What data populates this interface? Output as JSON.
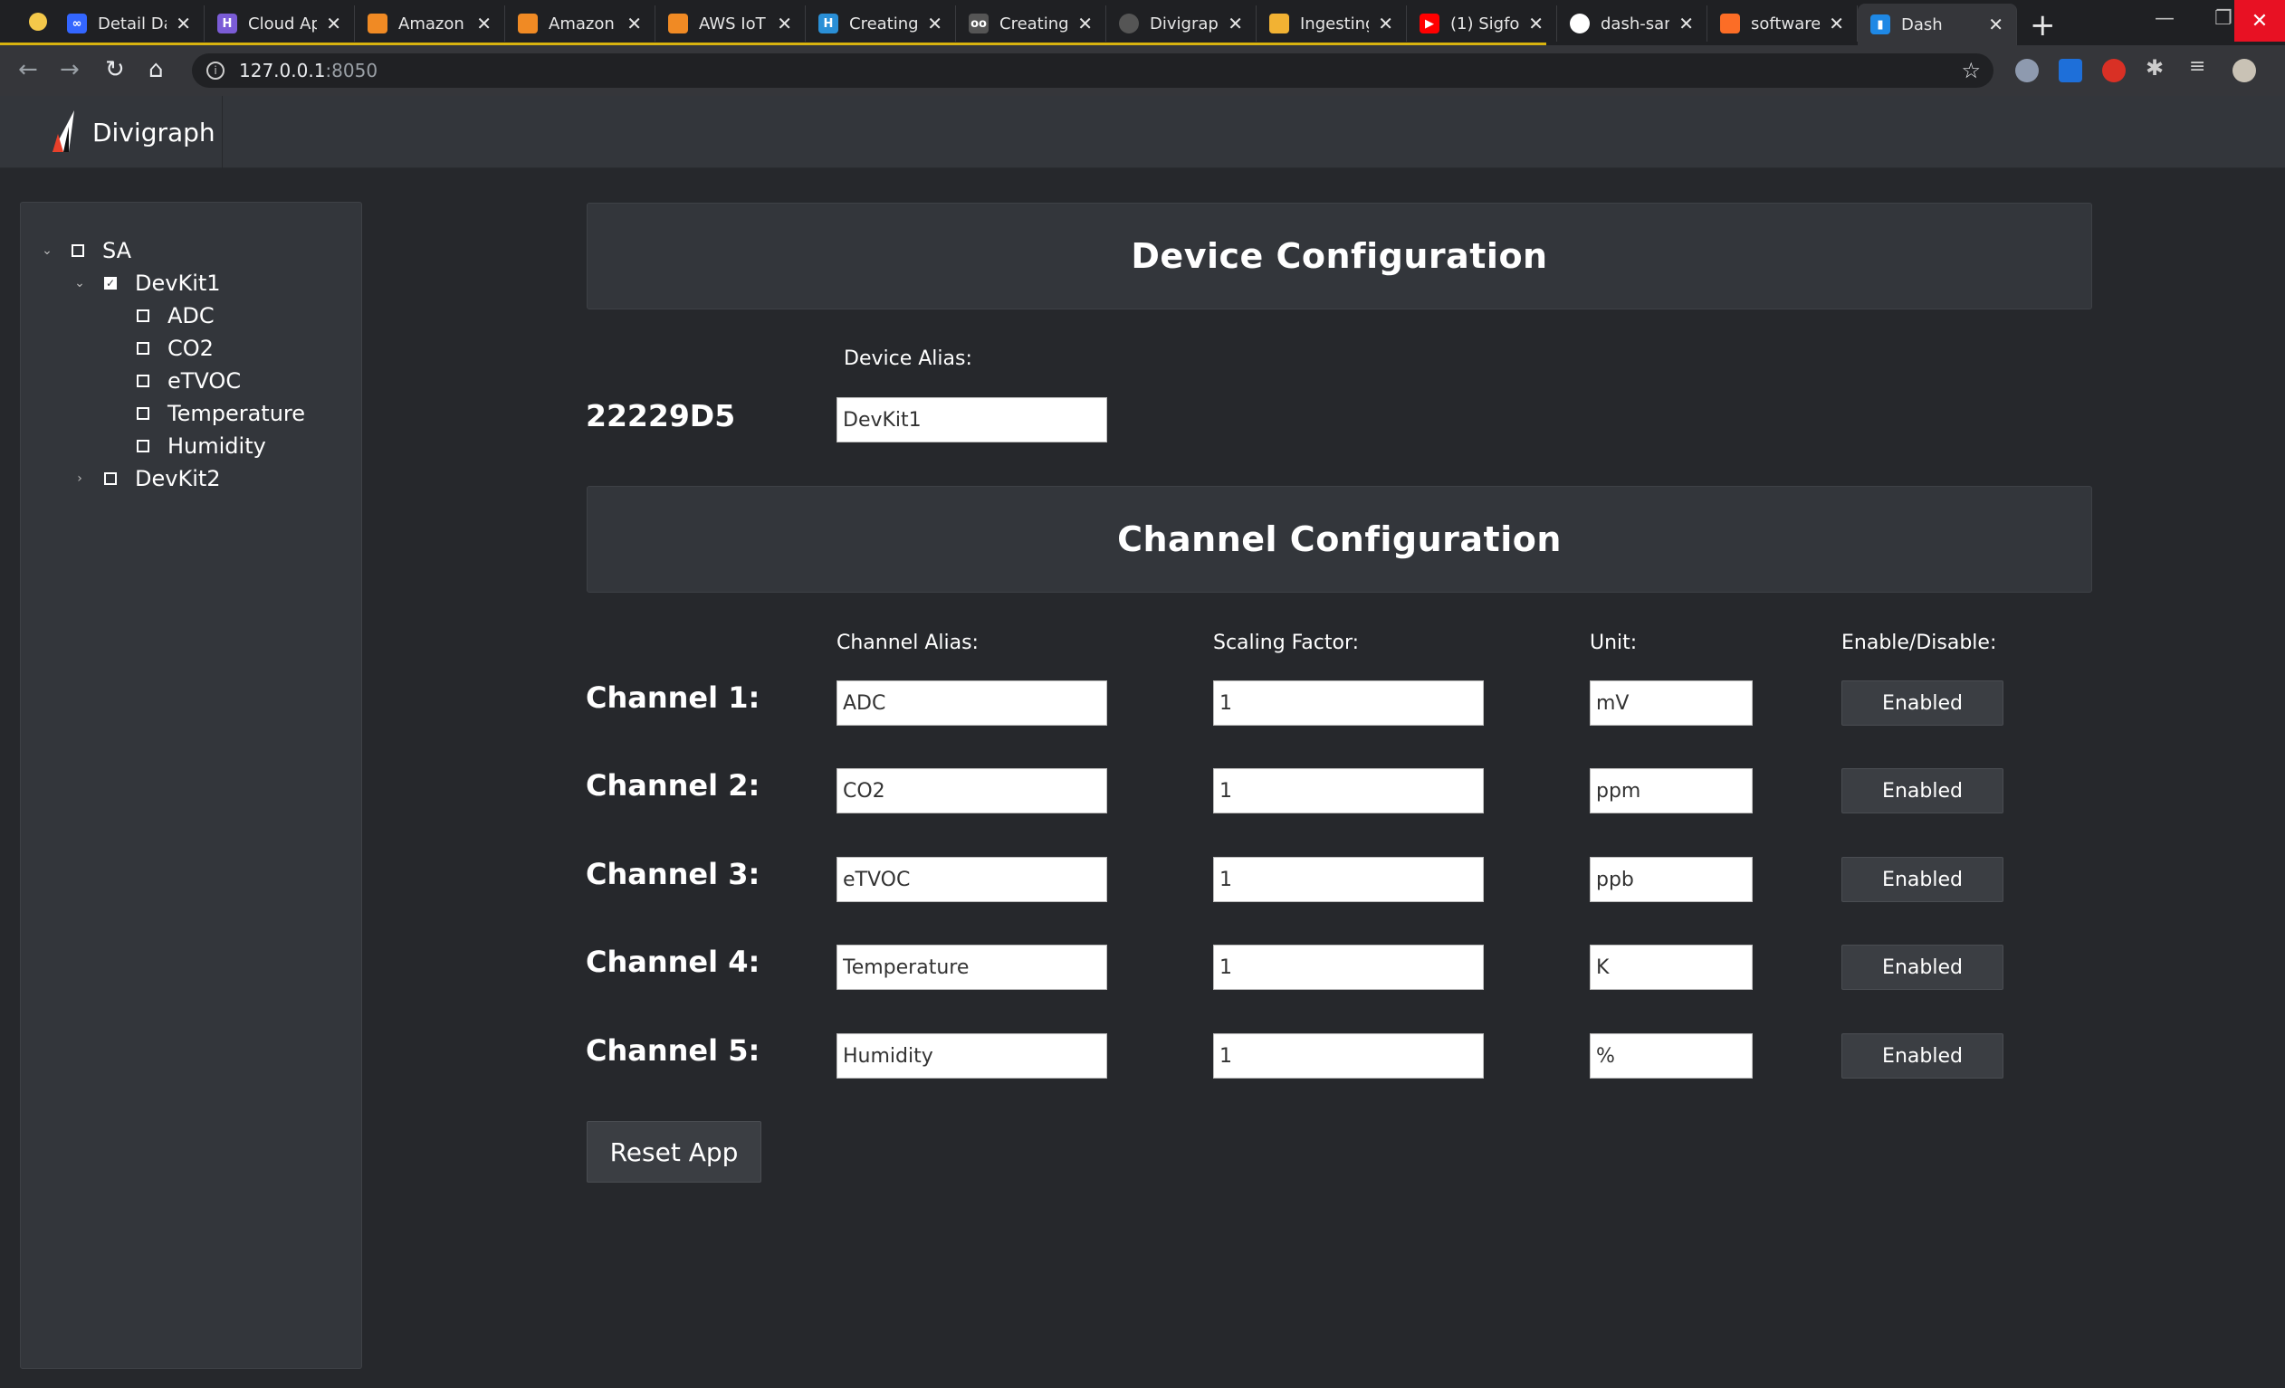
{
  "browser": {
    "tabs": [
      {
        "title": "Detail Da",
        "icon": "infinity-icon",
        "color": "#3366ff"
      },
      {
        "title": "Cloud Ap",
        "icon": "h-logo-icon",
        "color": "#7b5cd6"
      },
      {
        "title": "Amazon",
        "icon": "aws-hexagon-icon",
        "color": "#f08a24"
      },
      {
        "title": "Amazon",
        "icon": "aws-hexagon-icon",
        "color": "#f08a24"
      },
      {
        "title": "AWS IoT",
        "icon": "aws-hexagon-icon",
        "color": "#f08a24"
      },
      {
        "title": "Creating",
        "icon": "h-square-icon",
        "color": "#2a8fd6"
      },
      {
        "title": "Creating",
        "icon": "glasses-icon",
        "color": "#555555"
      },
      {
        "title": "Divigrap",
        "icon": "globe-icon",
        "color": "#555555"
      },
      {
        "title": "Ingesting",
        "icon": "box-icon",
        "color": "#f2b233"
      },
      {
        "title": "(1) Sigfo",
        "icon": "youtube-icon",
        "color": "#ff0000"
      },
      {
        "title": "dash-san",
        "icon": "github-icon",
        "color": "#ffffff"
      },
      {
        "title": "software",
        "icon": "gitlab-icon",
        "color": "#fc6d26"
      },
      {
        "title": "Dash",
        "icon": "dash-chart-icon",
        "color": "#1e88e5"
      }
    ],
    "url_host": "127.0.0.1",
    "url_port": ":8050"
  },
  "app": {
    "brand_name": "Divigraph"
  },
  "tree": {
    "root": "SA",
    "devkit1": "DevKit1",
    "channels": [
      "ADC",
      "CO2",
      "eTVOC",
      "Temperature",
      "Humidity"
    ],
    "devkit2": "DevKit2"
  },
  "device_config": {
    "title": "Device Configuration",
    "alias_label": "Device Alias:",
    "device_id": "22229D5",
    "alias_value": "DevKit1"
  },
  "channel_config": {
    "title": "Channel Configuration",
    "headers": {
      "alias": "Channel Alias:",
      "scaling": "Scaling Factor:",
      "unit": "Unit:",
      "enable": "Enable/Disable:"
    },
    "channels": [
      {
        "label": "Channel 1:",
        "alias": "ADC",
        "scaling": "1",
        "unit": "mV",
        "status": "Enabled"
      },
      {
        "label": "Channel 2:",
        "alias": "CO2",
        "scaling": "1",
        "unit": "ppm",
        "status": "Enabled"
      },
      {
        "label": "Channel 3:",
        "alias": "eTVOC",
        "scaling": "1",
        "unit": "ppb",
        "status": "Enabled"
      },
      {
        "label": "Channel 4:",
        "alias": "Temperature",
        "scaling": "1",
        "unit": "K",
        "status": "Enabled"
      },
      {
        "label": "Channel 5:",
        "alias": "Humidity",
        "scaling": "1",
        "unit": "%",
        "status": "Enabled"
      }
    ]
  },
  "reset_label": "Reset App"
}
